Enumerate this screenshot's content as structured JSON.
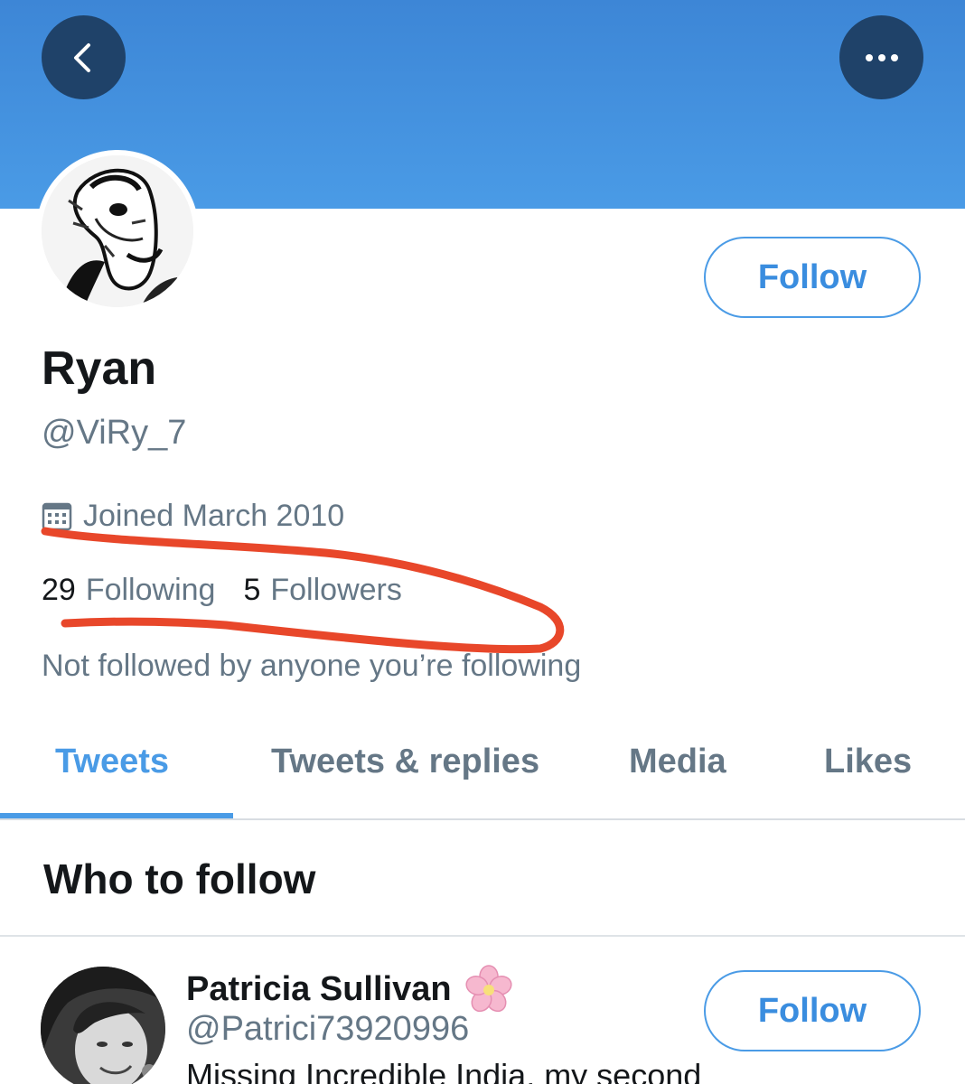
{
  "header": {
    "back_icon": "chevron-left-icon",
    "more_icon": "ellipsis-icon",
    "banner_color": "#4a9be6"
  },
  "profile": {
    "name": "Ryan",
    "handle": "@ViRy_7",
    "follow_label": "Follow",
    "joined_icon": "calendar-icon",
    "joined_text": "Joined March 2010",
    "following_count": "29",
    "following_label": "Following",
    "followers_count": "5",
    "followers_label": "Followers",
    "mutuals_text": "Not followed by anyone you’re following"
  },
  "tabs": [
    {
      "label": "Tweets",
      "active": true
    },
    {
      "label": "Tweets & replies",
      "active": false
    },
    {
      "label": "Media",
      "active": false
    },
    {
      "label": "Likes",
      "active": false
    }
  ],
  "who_to_follow": {
    "title": "Who to follow",
    "suggestions": [
      {
        "name": "Patricia Sullivan",
        "name_icon": "cherry-blossom-icon",
        "handle": "@Patrici73920996",
        "bio": "Missing Incredible India, my second",
        "follow_label": "Follow"
      }
    ]
  },
  "colors": {
    "accent": "#4a9be6",
    "annotation": "#e8472a",
    "secondary_text": "#657786"
  }
}
